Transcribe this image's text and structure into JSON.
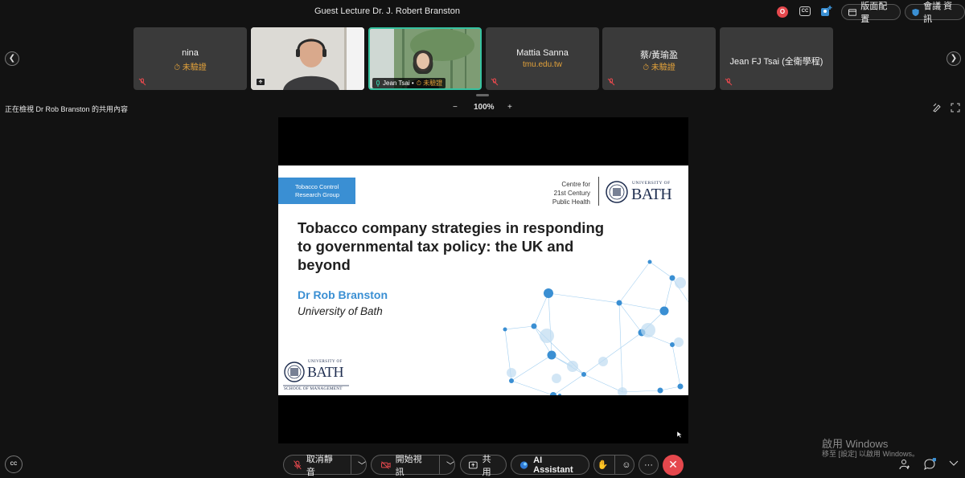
{
  "meeting": {
    "title": "Guest Lecture Dr. J. Robert Branston",
    "rec_label": "O",
    "cc_label": "CC",
    "layout_label": "版面配置",
    "info_label": "會議 資訊"
  },
  "participants": [
    {
      "name": "nina",
      "sub": "⏱ 未驗證",
      "type": "avatar"
    },
    {
      "name": "",
      "sub": "",
      "type": "video-man"
    },
    {
      "name": "Jean Tsai • ",
      "sub": "⏱ 未驗證",
      "type": "video-woman"
    },
    {
      "name": "Mattia Sanna",
      "sub": "tmu.edu.tw",
      "type": "avatar"
    },
    {
      "name": "蔡/黃瑜盈",
      "sub": "⏱ 未驗證",
      "type": "avatar"
    },
    {
      "name": "Jean FJ Tsai (全衛學程)",
      "sub": "",
      "type": "avatar"
    }
  ],
  "share": {
    "viewing_label": "正在檢視 Dr Rob Branston 的共用內容",
    "zoom_minus": "−",
    "zoom_level": "100%",
    "zoom_plus": "+"
  },
  "slide": {
    "tag_line1": "Tobacco Control",
    "tag_line2": "Research Group",
    "centre_line1": "Centre for",
    "centre_line2": "21st Century",
    "centre_line3": "Public Health",
    "logo_top": "UNIVERSITY OF",
    "logo_main": "BATH",
    "title": "Tobacco company strategies in responding to governmental tax policy: the UK and beyond",
    "presenter": "Dr Rob Branston",
    "affiliation": "University of Bath",
    "school_logo_top": "UNIVERSITY OF",
    "school_logo_main": "BATH",
    "school_logo_sub": "SCHOOL OF MANAGEMENT",
    "accent_color": "#3a8fd3"
  },
  "controls": {
    "mute_label": "取消靜音",
    "video_label": "開始視訊",
    "share_label": "共用",
    "ai_label": "AI Assistant",
    "more_label": "···",
    "end_label": "✕",
    "cc_label": "CC"
  },
  "watermark": {
    "line1": "啟用 Windows",
    "line2": "移至 [設定] 以啟用 Windows。"
  }
}
